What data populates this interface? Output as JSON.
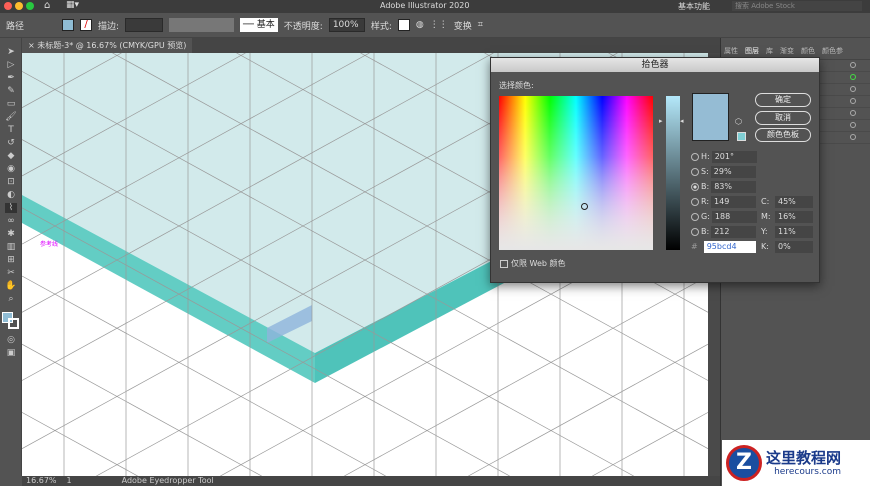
{
  "app": {
    "title": "Adobe Illustrator 2020",
    "workspace": "基本功能",
    "search_placeholder": "搜索 Adobe Stock"
  },
  "control": {
    "object": "路径",
    "stroke_label": "描边:",
    "stroke_style": "基本",
    "opacity_label": "不透明度:",
    "opacity": "100%",
    "style_label": "样式:",
    "transform": "变换",
    "fill_color": "#8fbcd4"
  },
  "doc_tab": "未标题-3* @ 16.67% (CMYK/GPU 预览)",
  "canvas": {
    "guide_label": "参考线",
    "slab_top": "#cde8e9",
    "slab_side": "#63cdc4"
  },
  "panel": {
    "tabs": [
      "属性",
      "图层",
      "库",
      "渐变",
      "颜色",
      "颜色参"
    ]
  },
  "status": {
    "zoom": "16.67%",
    "artboard": "1",
    "tool": "Adobe Eyedropper Tool"
  },
  "dialog": {
    "title": "拾色器",
    "select_label": "选择颜色:",
    "ok": "确定",
    "cancel": "取消",
    "swatches": "颜色色板",
    "web_only": "仅限 Web 颜色",
    "hash": "#",
    "color": "#95bcd4",
    "hsb": [
      {
        "k": "H:",
        "v": "201°"
      },
      {
        "k": "S:",
        "v": "29%"
      },
      {
        "k": "B:",
        "v": "83%",
        "checked": true
      }
    ],
    "rgb": [
      {
        "k": "R:",
        "v": "149"
      },
      {
        "k": "G:",
        "v": "188"
      },
      {
        "k": "B:",
        "v": "212"
      }
    ],
    "cmyk": [
      {
        "k": "C:",
        "v": "45%"
      },
      {
        "k": "M:",
        "v": "16%"
      },
      {
        "k": "Y:",
        "v": "11%"
      },
      {
        "k": "K:",
        "v": "0%"
      }
    ],
    "hex": "95bcd4"
  },
  "watermark": {
    "name": "这里教程网",
    "url": "herecours.com"
  }
}
